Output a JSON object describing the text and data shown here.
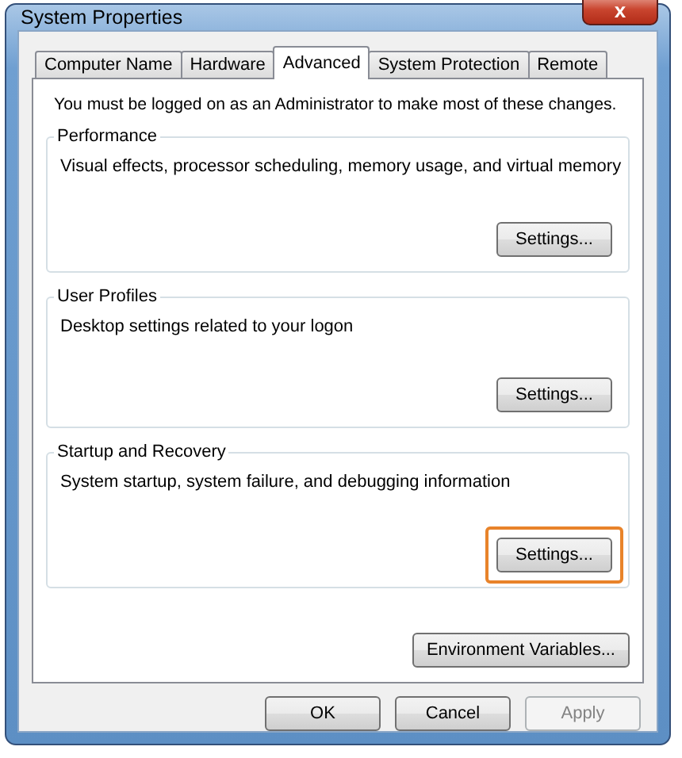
{
  "window": {
    "title": "System Properties",
    "close_label": "x"
  },
  "tabs": [
    {
      "label": "Computer Name",
      "selected": false
    },
    {
      "label": "Hardware",
      "selected": false
    },
    {
      "label": "Advanced",
      "selected": true
    },
    {
      "label": "System Protection",
      "selected": false
    },
    {
      "label": "Remote",
      "selected": false
    }
  ],
  "notice": "You must be logged on as an Administrator to make most of these changes.",
  "groups": [
    {
      "title": "Performance",
      "description": "Visual effects, processor scheduling, memory usage, and virtual memory",
      "button": "Settings...",
      "highlighted": false
    },
    {
      "title": "User Profiles",
      "description": "Desktop settings related to your logon",
      "button": "Settings...",
      "highlighted": false
    },
    {
      "title": "Startup and Recovery",
      "description": "System startup, system failure, and debugging information",
      "button": "Settings...",
      "highlighted": true
    }
  ],
  "environment_button": "Environment Variables...",
  "buttons": [
    {
      "label": "OK",
      "disabled": false
    },
    {
      "label": "Cancel",
      "disabled": false
    },
    {
      "label": "Apply",
      "disabled": true
    }
  ]
}
